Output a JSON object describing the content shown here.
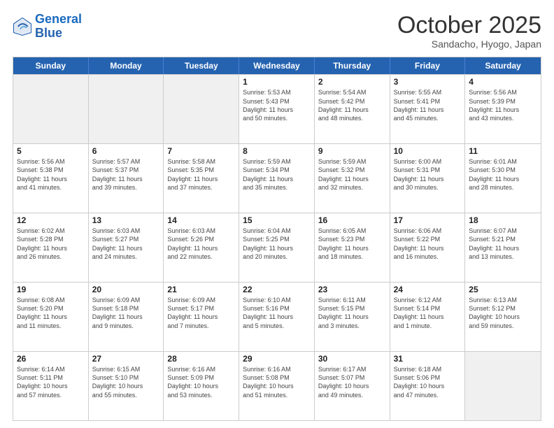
{
  "header": {
    "logo_general": "General",
    "logo_blue": "Blue",
    "month": "October 2025",
    "location": "Sandacho, Hyogo, Japan"
  },
  "weekdays": [
    "Sunday",
    "Monday",
    "Tuesday",
    "Wednesday",
    "Thursday",
    "Friday",
    "Saturday"
  ],
  "rows": [
    [
      {
        "day": "",
        "info": ""
      },
      {
        "day": "",
        "info": ""
      },
      {
        "day": "",
        "info": ""
      },
      {
        "day": "1",
        "info": "Sunrise: 5:53 AM\nSunset: 5:43 PM\nDaylight: 11 hours\nand 50 minutes."
      },
      {
        "day": "2",
        "info": "Sunrise: 5:54 AM\nSunset: 5:42 PM\nDaylight: 11 hours\nand 48 minutes."
      },
      {
        "day": "3",
        "info": "Sunrise: 5:55 AM\nSunset: 5:41 PM\nDaylight: 11 hours\nand 45 minutes."
      },
      {
        "day": "4",
        "info": "Sunrise: 5:56 AM\nSunset: 5:39 PM\nDaylight: 11 hours\nand 43 minutes."
      }
    ],
    [
      {
        "day": "5",
        "info": "Sunrise: 5:56 AM\nSunset: 5:38 PM\nDaylight: 11 hours\nand 41 minutes."
      },
      {
        "day": "6",
        "info": "Sunrise: 5:57 AM\nSunset: 5:37 PM\nDaylight: 11 hours\nand 39 minutes."
      },
      {
        "day": "7",
        "info": "Sunrise: 5:58 AM\nSunset: 5:35 PM\nDaylight: 11 hours\nand 37 minutes."
      },
      {
        "day": "8",
        "info": "Sunrise: 5:59 AM\nSunset: 5:34 PM\nDaylight: 11 hours\nand 35 minutes."
      },
      {
        "day": "9",
        "info": "Sunrise: 5:59 AM\nSunset: 5:32 PM\nDaylight: 11 hours\nand 32 minutes."
      },
      {
        "day": "10",
        "info": "Sunrise: 6:00 AM\nSunset: 5:31 PM\nDaylight: 11 hours\nand 30 minutes."
      },
      {
        "day": "11",
        "info": "Sunrise: 6:01 AM\nSunset: 5:30 PM\nDaylight: 11 hours\nand 28 minutes."
      }
    ],
    [
      {
        "day": "12",
        "info": "Sunrise: 6:02 AM\nSunset: 5:28 PM\nDaylight: 11 hours\nand 26 minutes."
      },
      {
        "day": "13",
        "info": "Sunrise: 6:03 AM\nSunset: 5:27 PM\nDaylight: 11 hours\nand 24 minutes."
      },
      {
        "day": "14",
        "info": "Sunrise: 6:03 AM\nSunset: 5:26 PM\nDaylight: 11 hours\nand 22 minutes."
      },
      {
        "day": "15",
        "info": "Sunrise: 6:04 AM\nSunset: 5:25 PM\nDaylight: 11 hours\nand 20 minutes."
      },
      {
        "day": "16",
        "info": "Sunrise: 6:05 AM\nSunset: 5:23 PM\nDaylight: 11 hours\nand 18 minutes."
      },
      {
        "day": "17",
        "info": "Sunrise: 6:06 AM\nSunset: 5:22 PM\nDaylight: 11 hours\nand 16 minutes."
      },
      {
        "day": "18",
        "info": "Sunrise: 6:07 AM\nSunset: 5:21 PM\nDaylight: 11 hours\nand 13 minutes."
      }
    ],
    [
      {
        "day": "19",
        "info": "Sunrise: 6:08 AM\nSunset: 5:20 PM\nDaylight: 11 hours\nand 11 minutes."
      },
      {
        "day": "20",
        "info": "Sunrise: 6:09 AM\nSunset: 5:18 PM\nDaylight: 11 hours\nand 9 minutes."
      },
      {
        "day": "21",
        "info": "Sunrise: 6:09 AM\nSunset: 5:17 PM\nDaylight: 11 hours\nand 7 minutes."
      },
      {
        "day": "22",
        "info": "Sunrise: 6:10 AM\nSunset: 5:16 PM\nDaylight: 11 hours\nand 5 minutes."
      },
      {
        "day": "23",
        "info": "Sunrise: 6:11 AM\nSunset: 5:15 PM\nDaylight: 11 hours\nand 3 minutes."
      },
      {
        "day": "24",
        "info": "Sunrise: 6:12 AM\nSunset: 5:14 PM\nDaylight: 11 hours\nand 1 minute."
      },
      {
        "day": "25",
        "info": "Sunrise: 6:13 AM\nSunset: 5:12 PM\nDaylight: 10 hours\nand 59 minutes."
      }
    ],
    [
      {
        "day": "26",
        "info": "Sunrise: 6:14 AM\nSunset: 5:11 PM\nDaylight: 10 hours\nand 57 minutes."
      },
      {
        "day": "27",
        "info": "Sunrise: 6:15 AM\nSunset: 5:10 PM\nDaylight: 10 hours\nand 55 minutes."
      },
      {
        "day": "28",
        "info": "Sunrise: 6:16 AM\nSunset: 5:09 PM\nDaylight: 10 hours\nand 53 minutes."
      },
      {
        "day": "29",
        "info": "Sunrise: 6:16 AM\nSunset: 5:08 PM\nDaylight: 10 hours\nand 51 minutes."
      },
      {
        "day": "30",
        "info": "Sunrise: 6:17 AM\nSunset: 5:07 PM\nDaylight: 10 hours\nand 49 minutes."
      },
      {
        "day": "31",
        "info": "Sunrise: 6:18 AM\nSunset: 5:06 PM\nDaylight: 10 hours\nand 47 minutes."
      },
      {
        "day": "",
        "info": ""
      }
    ]
  ]
}
